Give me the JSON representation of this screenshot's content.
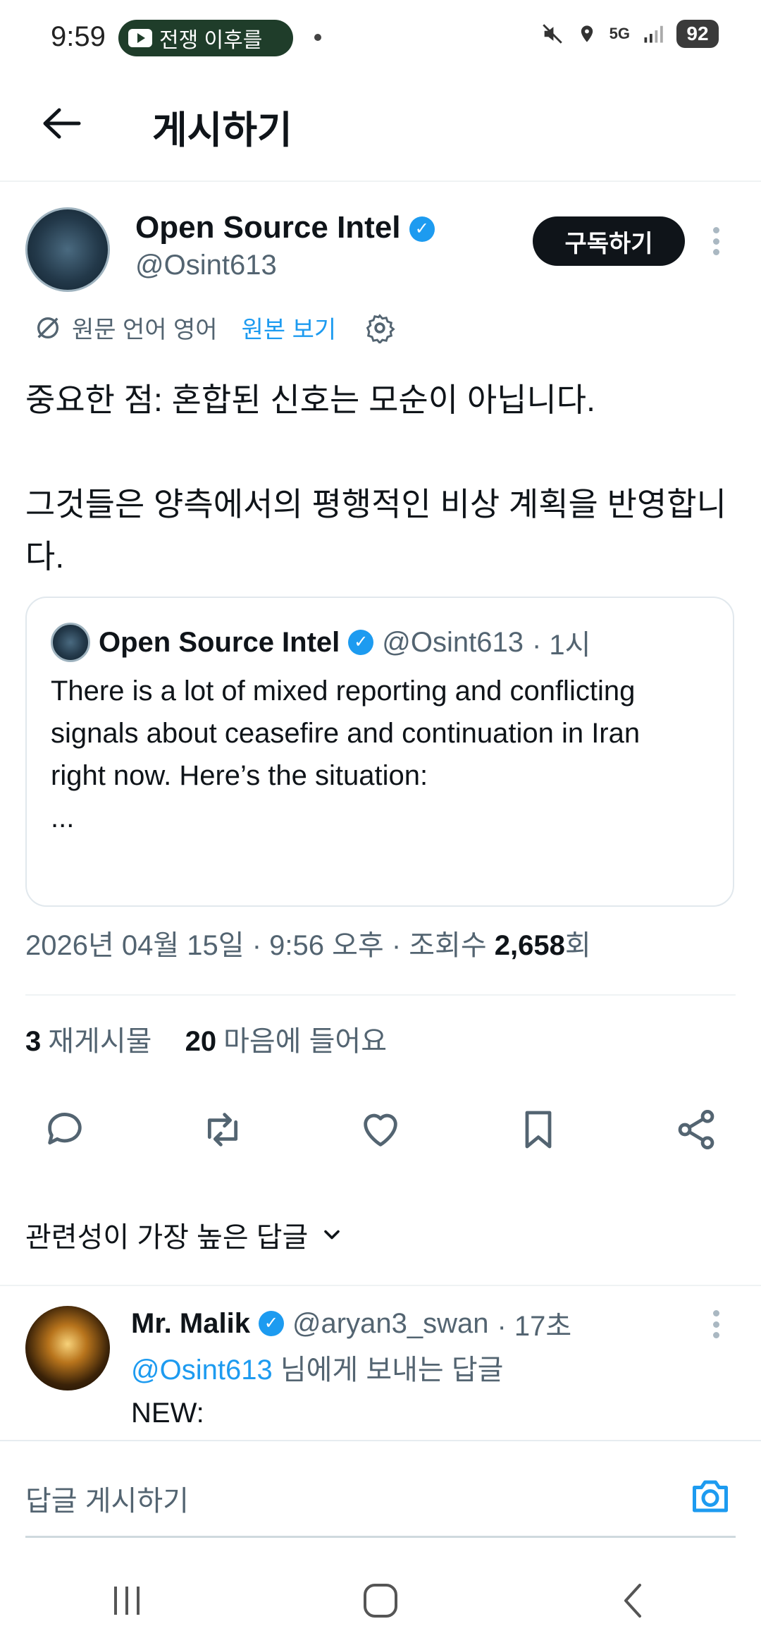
{
  "status_bar": {
    "time": "9:59",
    "youtube_pill": "전쟁 이후를",
    "battery": "92",
    "network": "5G"
  },
  "header": {
    "title": "게시하기"
  },
  "post": {
    "author_name": "Open Source Intel",
    "author_handle": "@Osint613",
    "subscribe_label": "구독하기",
    "translation_note": "원문 언어 영어",
    "show_original": "원본 보기",
    "text": "중요한 점: 혼합된 신호는 모순이 아닙니다.\n\n그것들은 양측에서의 평행적인 비상 계획을 반영합니다.",
    "quote": {
      "author_name": "Open Source Intel",
      "author_handle": "@Osint613",
      "time": "· 1시",
      "text": "There is a lot of mixed reporting and conflicting signals about ceasefire and continuation in Iran right now. Here’s the situation:\n..."
    },
    "meta_prefix": "2026년 04월 15일 · 9:56 오후 · 조회수 ",
    "views": "2,658",
    "views_suffix": "회",
    "reposts_count": "3",
    "reposts_label": "재게시물",
    "likes_count": "20",
    "likes_label": "마음에 들어요"
  },
  "replies": {
    "sort_label": "관련성이 가장 높은 답글",
    "items": [
      {
        "author_name": "Mr. Malik",
        "author_handle": "@aryan3_swan",
        "time": "· 17초",
        "reply_to_mention": "@Osint613",
        "reply_to_suffix": " 님에게 보내는 답글",
        "text": "NEW:"
      }
    ]
  },
  "composer": {
    "placeholder": "답글 게시하기"
  },
  "colors": {
    "accent": "#1d9bf0",
    "text": "#0f1419",
    "muted": "#536471"
  }
}
